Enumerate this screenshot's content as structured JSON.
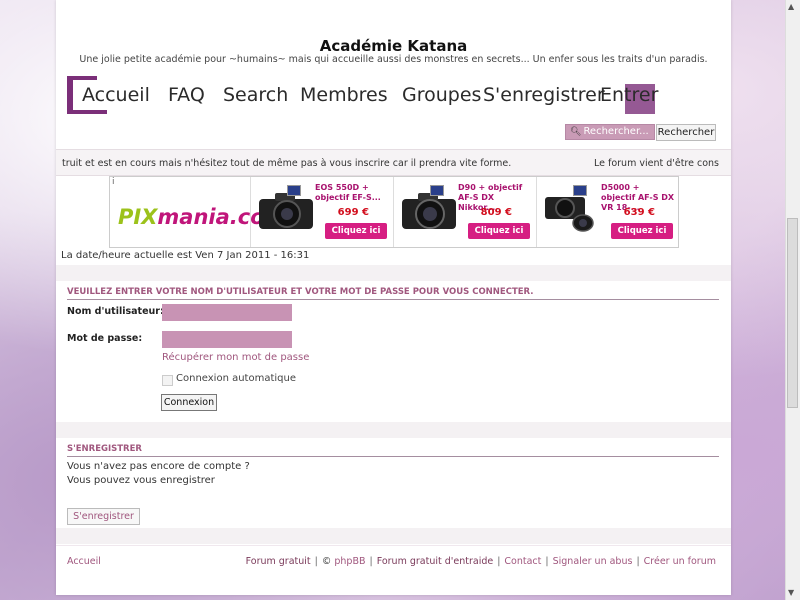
{
  "header": {
    "site_title": "Académie Katana",
    "site_description": "Une jolie petite académie pour ~humains~ mais qui accueille aussi des monstres en secrets... Un enfer sous les traits d'un paradis."
  },
  "nav": {
    "items": [
      {
        "label": "Accueil"
      },
      {
        "label": "FAQ"
      },
      {
        "label": "Search"
      },
      {
        "label": "Membres"
      },
      {
        "label": "Groupes"
      },
      {
        "label": "S'enregistrer"
      },
      {
        "label": "Entrer"
      }
    ]
  },
  "search": {
    "placeholder": "Rechercher...",
    "button_label": "Rechercher"
  },
  "marquee": {
    "left_text": "truit et est en cours mais n'hésitez tout de même pas à vous inscrire car il prendra vite forme.",
    "right_text": "Le forum vient d'être cons"
  },
  "ad": {
    "info": "i",
    "logo_part1": "PIX",
    "logo_part2": "mania.com",
    "products": [
      {
        "name": "EOS 550D + objectif EF-S...",
        "price": "699 €",
        "cta": "Cliquez ici"
      },
      {
        "name": "D90 + objectif AF-S DX Nikkor...",
        "price": "809 €",
        "cta": "Cliquez ici"
      },
      {
        "name": "D5000 + objectif AF-S DX VR 18-...",
        "price": "639 €",
        "cta": "Cliquez ici"
      }
    ]
  },
  "datetime": "La date/heure actuelle est Ven 7 Jan 2011 - 16:31",
  "login": {
    "heading": "Veuillez entrer votre nom d'utilisateur et votre mot de passe pour vous connecter.",
    "username_label": "Nom d'utilisateur:",
    "password_label": "Mot de passe:",
    "forgot_password": "Récupérer mon mot de passe",
    "auto_login": "Connexion automatique",
    "submit_label": "Connexion"
  },
  "register": {
    "heading": "S'enregistrer",
    "line1": "Vous n'avez pas encore de compte ?",
    "line2": "Vous pouvez vous enregistrer",
    "button_label": "S'enregistrer"
  },
  "footer": {
    "home": "Accueil",
    "links": [
      {
        "label": "Forum gratuit"
      },
      {
        "label": "©"
      },
      {
        "label": "phpBB"
      },
      {
        "label": "Forum gratuit d'entraide"
      },
      {
        "label": "Contact"
      },
      {
        "label": "Signaler un abus"
      },
      {
        "label": "Créer un forum"
      }
    ]
  },
  "colors": {
    "accent": "#a0577e",
    "field_bg": "#c893b4",
    "nav_deco": "#7b2f79",
    "cta": "#d61e82"
  }
}
